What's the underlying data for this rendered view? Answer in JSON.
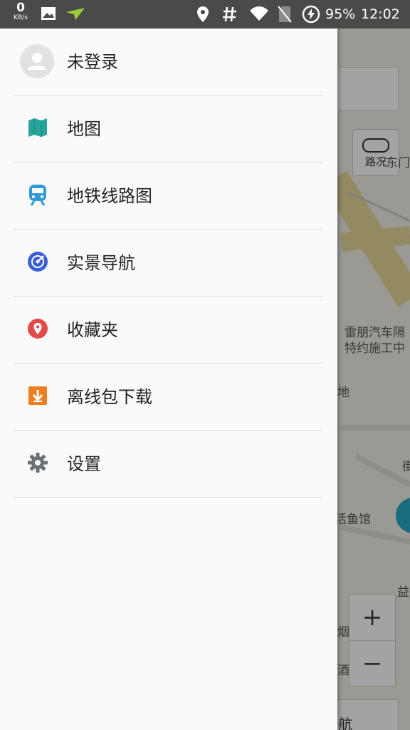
{
  "status_bar": {
    "net_speed": "0",
    "net_unit": "KB/s",
    "icons": [
      "image-icon",
      "send-icon",
      "location-icon",
      "hash-icon",
      "wifi-icon",
      "no-sim-icon",
      "battery-saver-icon"
    ],
    "battery": "95%",
    "time": "12:02"
  },
  "drawer": {
    "user_label": "未登录",
    "items": [
      {
        "label": "地图",
        "icon": "map-icon",
        "color": "#26a69a"
      },
      {
        "label": "地铁线路图",
        "icon": "subway-icon",
        "color": "#2f9ad6"
      },
      {
        "label": "实景导航",
        "icon": "compass-icon",
        "color": "#3a5ed6"
      },
      {
        "label": "收藏夹",
        "icon": "favorite-pin-icon",
        "color": "#e24a4a"
      },
      {
        "label": "离线包下载",
        "icon": "download-icon",
        "color": "#ef7d22"
      },
      {
        "label": "设置",
        "icon": "gear-icon",
        "color": "#6b6f78"
      }
    ]
  },
  "map": {
    "traffic_label": "路况",
    "labels": [
      "东门",
      "雷朋汽车隔",
      "特约施工中",
      "地",
      "街",
      "活鱼馆",
      "益",
      "烟",
      "酒店"
    ],
    "zoom_in": "+",
    "zoom_out": "−",
    "nav_label": "航"
  }
}
